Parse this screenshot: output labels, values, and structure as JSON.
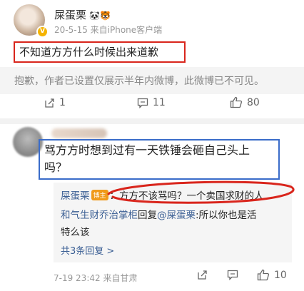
{
  "post": {
    "username": "屎蛋栗",
    "username_emoji": "🐼🐯",
    "verified_mark": "V",
    "meta": "20-5-15  来自iPhone客户端",
    "title": "不知道方方什么时候出来道歉",
    "hidden_notice": "抱歉，作者已设置仅展示半年内微博，此微博已不可见。",
    "actions": {
      "repost_count": "1",
      "comment_count": "11",
      "like_count": "80"
    }
  },
  "comment": {
    "text_line1": "骂方方时想到过有一天铁锤会砸自己头上",
    "text_line2": "吗？",
    "reply": {
      "author": "屎蛋栗",
      "author_badge": "博主",
      "line1_text": "：方方不该骂吗？一个卖国求财的人",
      "line2_prefix": "和气生财乔治掌柜",
      "line2_middle": "回复",
      "line2_mention": "@屎蛋栗",
      "line2_text": ":所以你也是活",
      "line3_text": "特么该",
      "more": "共3条回复 >"
    },
    "meta": "7-19 23:42  来自甘肃",
    "actions": {
      "comment_count": "",
      "like_count": "10"
    }
  },
  "colors": {
    "highlight_red": "#d9251c",
    "highlight_blue": "#3a6cc9",
    "link_blue": "#3b5f94"
  }
}
